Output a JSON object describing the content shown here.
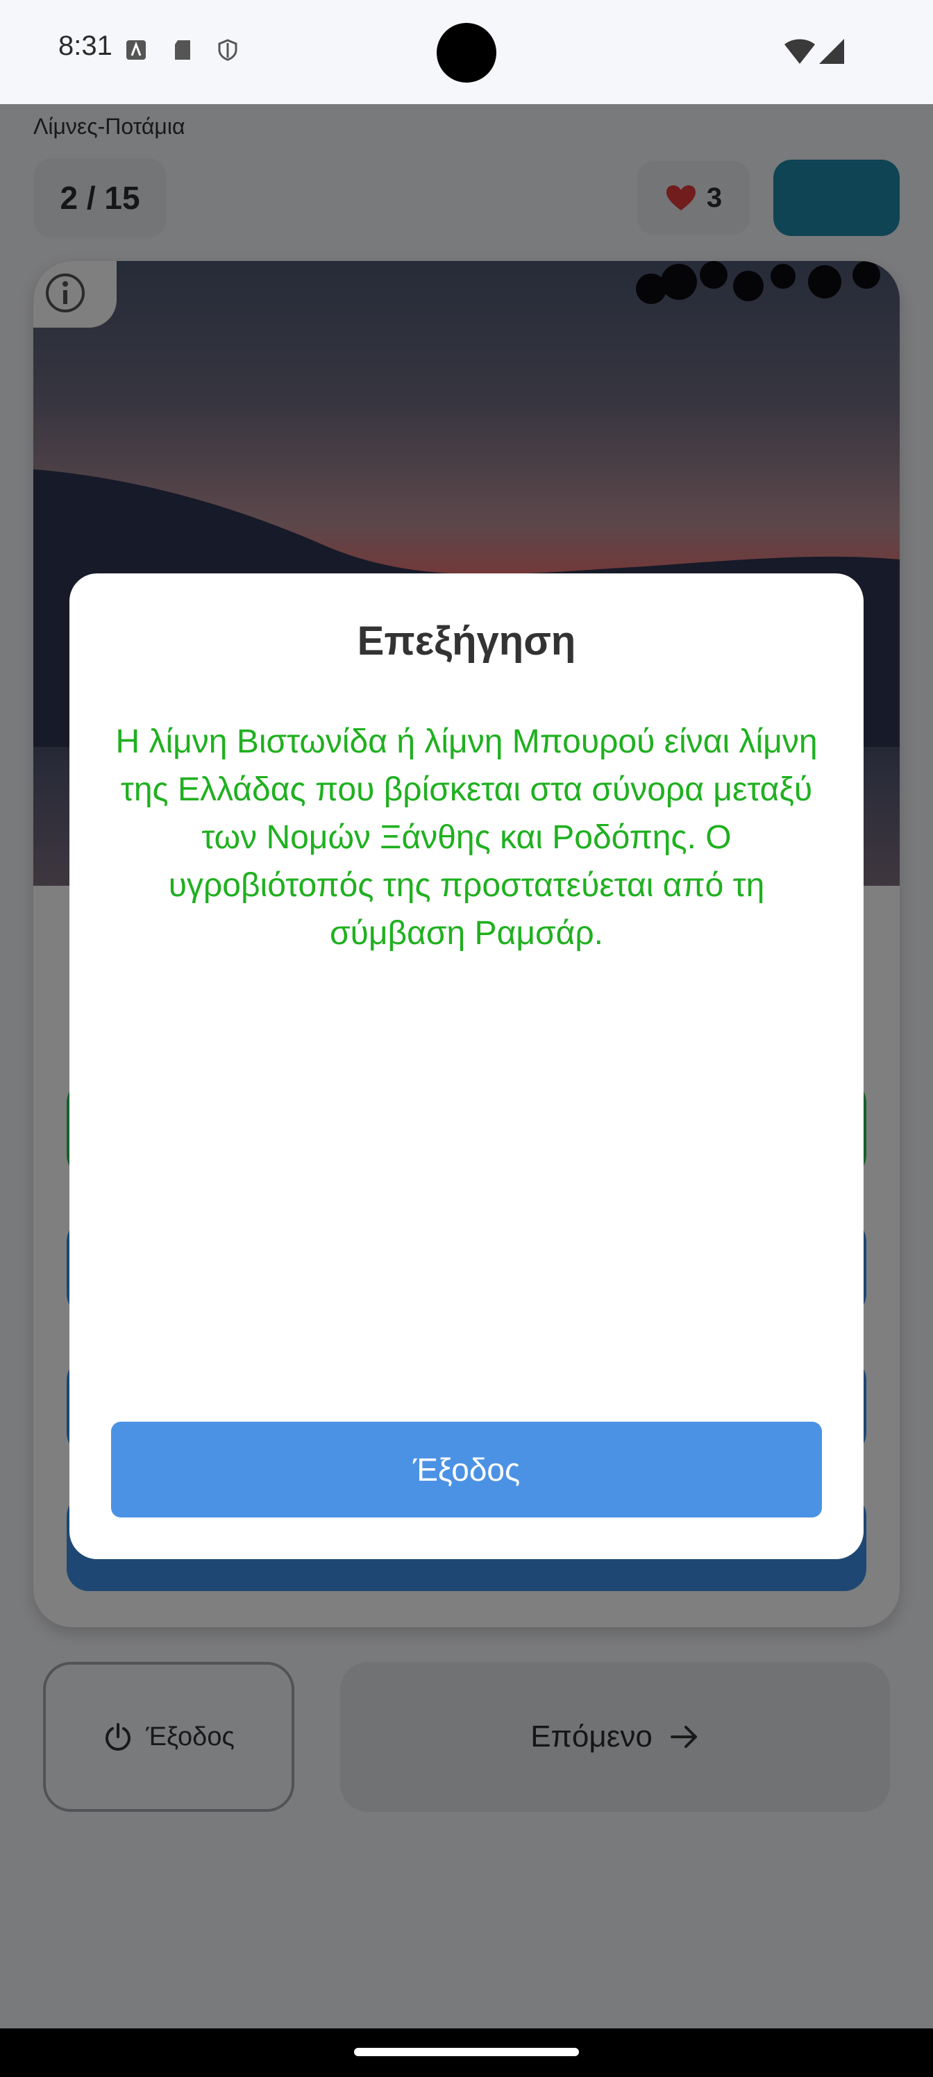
{
  "status_bar": {
    "time": "8:31"
  },
  "header": {
    "category": "Λίμνες-Ποτάμια",
    "counter": "2 / 15",
    "lives": "3"
  },
  "controls": {
    "exit_label": "Έξοδος",
    "next_label": "Επόμενο"
  },
  "dialog": {
    "title": "Επεξήγηση",
    "body": "Η λίμνη Βιστωνίδα ή λίμνη Μπουρού είναι λίμνη της Ελλάδας που βρίσκεται στα σύνορα μεταξύ των Νομών Ξάνθης και Ροδόπης. Ο υγροβιότοπός της προστατεύεται από τη σύμβαση Ραμσάρ.",
    "exit_label": "Έξοδος"
  },
  "colors": {
    "body_text": "#1fb01f",
    "primary_button": "#4c92e4",
    "correct_answer": "#2ebe5b",
    "answer": "#3d8fe6",
    "accent": "#1e89a9"
  }
}
